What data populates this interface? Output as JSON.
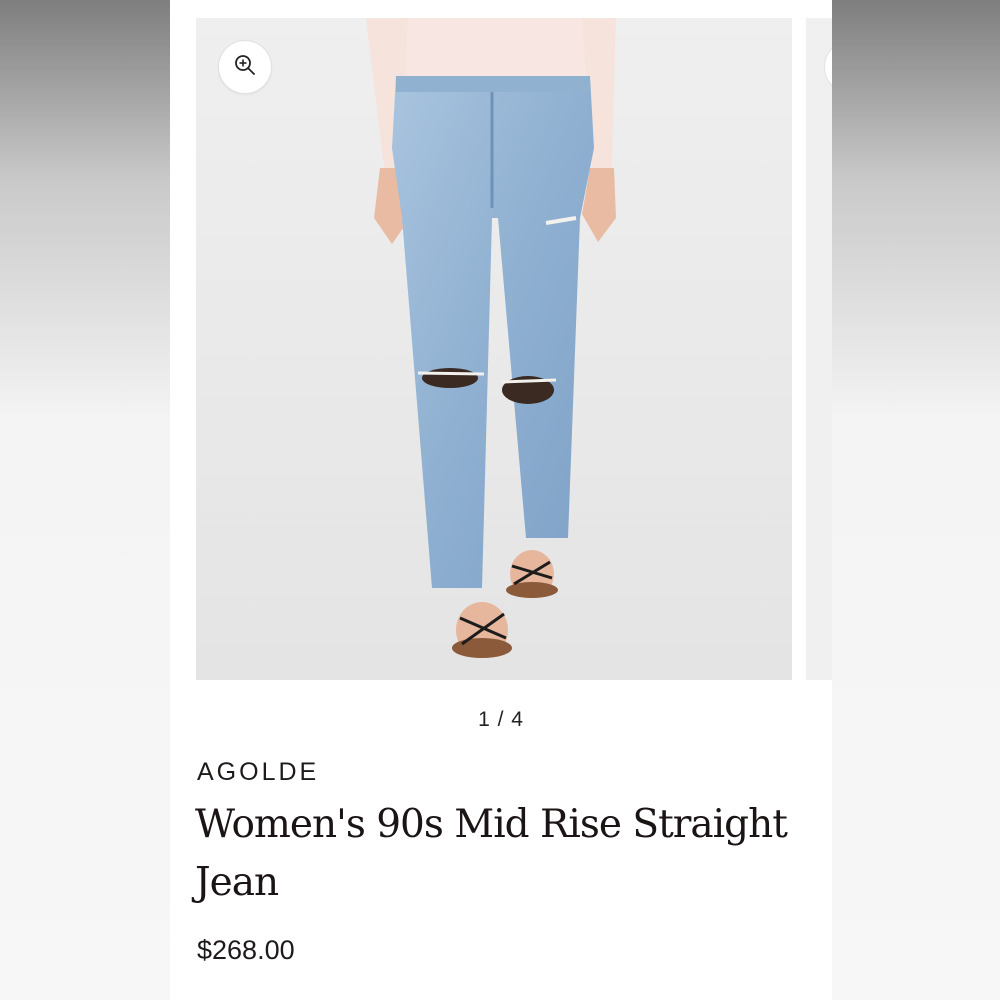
{
  "gallery": {
    "counter": "1 / 4",
    "zoom_icon": "zoom-in-icon"
  },
  "product": {
    "brand": "AGOLDE",
    "title": "Women's 90s Mid Rise Straight Jean",
    "price": "$268.00"
  },
  "colors": {
    "denim": "#9db9d6",
    "sweater": "#f7e6e1",
    "background": "#ffffff",
    "text": "#1b1414"
  }
}
